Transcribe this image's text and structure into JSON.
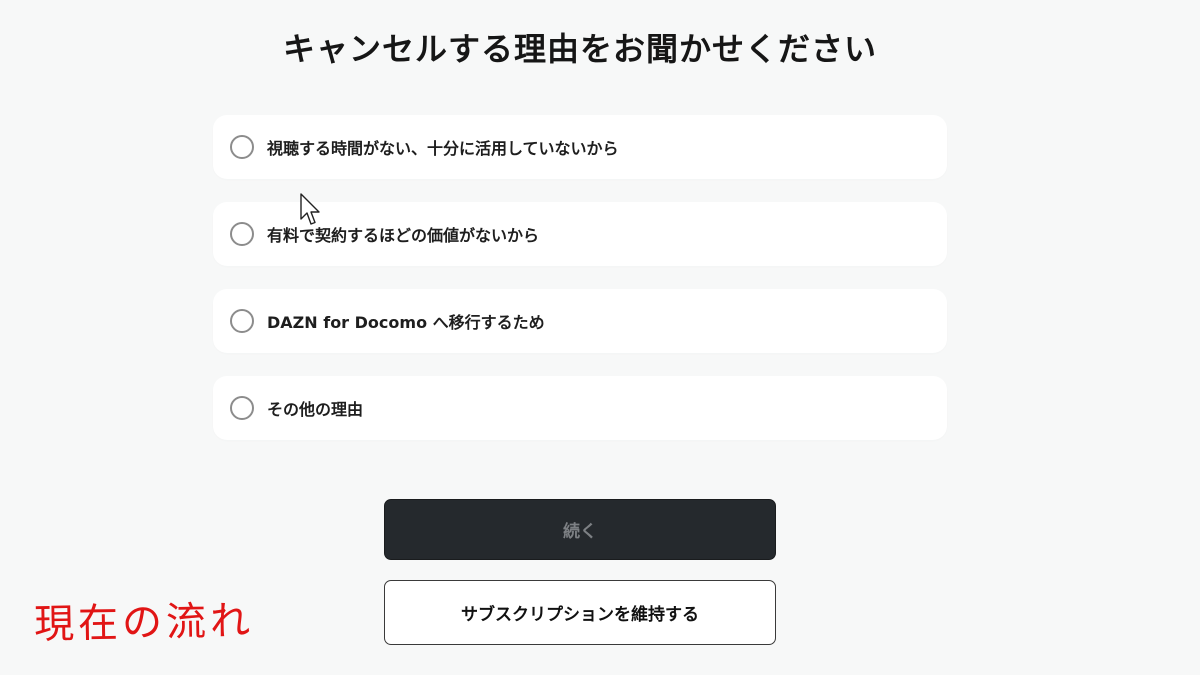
{
  "page": {
    "title": "キャンセルする理由をお聞かせください"
  },
  "options": [
    {
      "label": "視聴する時間がない、十分に活用していないから"
    },
    {
      "label": "有料で契約するほどの価値がないから"
    },
    {
      "label": "DAZN for Docomo へ移行するため"
    },
    {
      "label": "その他の理由"
    }
  ],
  "buttons": {
    "continue_label": "続く",
    "keep_subscription_label": "サブスクリプションを維持する"
  },
  "annotation": {
    "text": "現在の流れ",
    "color": "#e11515"
  },
  "colors": {
    "background": "#f7f8f8",
    "continue_button_bg": "#25292d",
    "continue_button_text": "#7d8084"
  },
  "icons": {
    "radio": "radio-unchecked-icon",
    "cursor": "mouse-pointer-icon"
  }
}
